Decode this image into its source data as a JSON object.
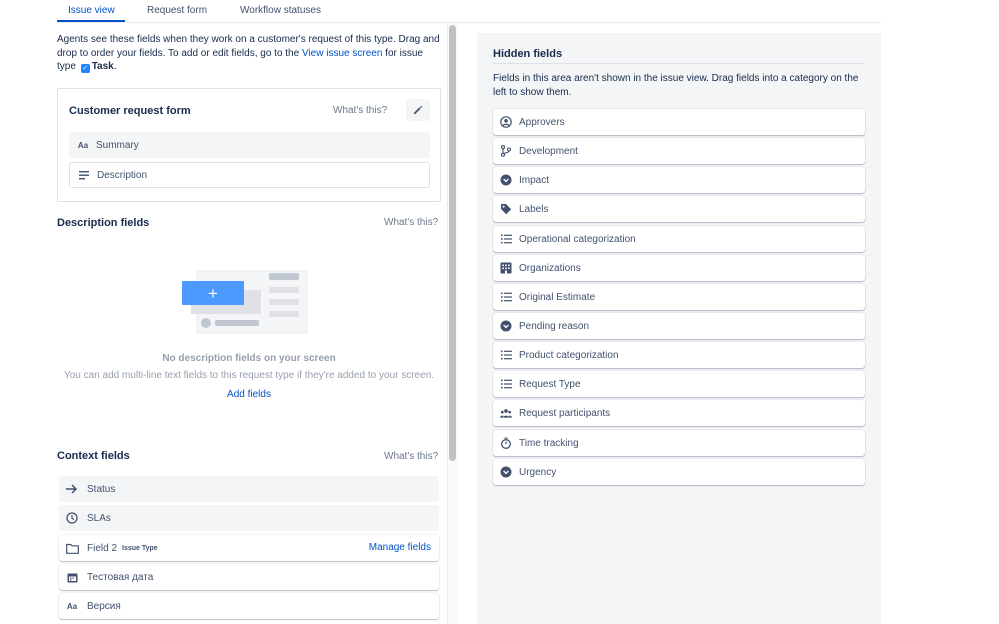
{
  "tabs": [
    {
      "label": "Issue view"
    },
    {
      "label": "Request form"
    },
    {
      "label": "Workflow statuses"
    }
  ],
  "intro": {
    "text_before": "Agents see these fields when they work on a customer's request of this type. Drag and drop to order your fields. To add or edit fields, go to the ",
    "link": "View issue screen",
    "text_mid": " for issue type ",
    "issue_type": "Task",
    "text_end": "."
  },
  "customer_request_form": {
    "title": "Customer request form",
    "whats_this": "What's this?",
    "items": [
      {
        "label": "Summary",
        "icon": "Aa"
      },
      {
        "label": "Description"
      }
    ]
  },
  "description_fields": {
    "title": "Description fields",
    "whats_this": "What's this?",
    "empty_title": "No description fields on your screen",
    "empty_desc": "You can add multi-line text fields to this request type if they're added to your screen.",
    "add_fields": "Add fields",
    "illustration_plus": "+"
  },
  "context_fields": {
    "title": "Context fields",
    "whats_this": "What's this?",
    "items": [
      {
        "label": "Status"
      },
      {
        "label": "SLAs"
      },
      {
        "label": "Field 2",
        "sub": "Issue Type",
        "action": "Manage fields"
      },
      {
        "label": "Тестовая дата"
      },
      {
        "label": "Версия",
        "icon": "Aa"
      }
    ]
  },
  "hidden_fields": {
    "title": "Hidden fields",
    "desc": "Fields in this area aren't shown in the issue view. Drag fields into a category on the left to show them.",
    "items": [
      {
        "label": "Approvers",
        "icon": "person-circle-icon"
      },
      {
        "label": "Development",
        "icon": "branch-icon"
      },
      {
        "label": "Impact",
        "icon": "chevron-circle-icon"
      },
      {
        "label": "Labels",
        "icon": "tag-icon"
      },
      {
        "label": "Operational categorization",
        "icon": "list-icon"
      },
      {
        "label": "Organizations",
        "icon": "organization-icon"
      },
      {
        "label": "Original Estimate",
        "icon": "list-icon"
      },
      {
        "label": "Pending reason",
        "icon": "chevron-circle-icon"
      },
      {
        "label": "Product categorization",
        "icon": "list-icon"
      },
      {
        "label": "Request Type",
        "icon": "list-icon"
      },
      {
        "label": "Request participants",
        "icon": "people-icon"
      },
      {
        "label": "Time tracking",
        "icon": "stopwatch-icon"
      },
      {
        "label": "Urgency",
        "icon": "chevron-circle-icon"
      }
    ]
  },
  "colors": {
    "accent": "#0052cc",
    "text": "#172b4d",
    "subtle": "#6b778c",
    "panel_bg": "#f4f5f7"
  }
}
